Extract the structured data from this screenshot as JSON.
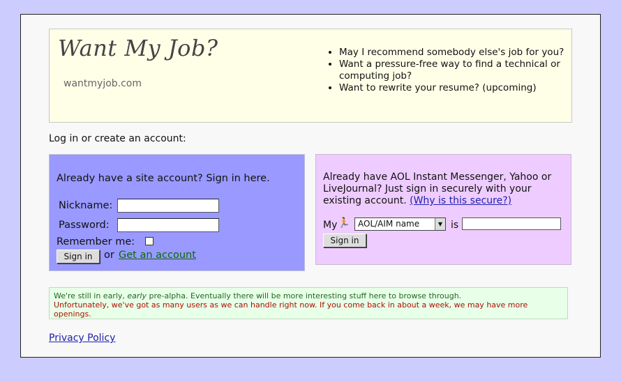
{
  "header": {
    "title": "Want My Job?",
    "domain": "wantmyjob.com",
    "pitch": [
      "May I recommend somebody else's job for you?",
      "Want a pressure-free way to find a technical or computing job?",
      "Want to rewrite your resume? (upcoming)"
    ]
  },
  "prompt": "Log in or create an account:",
  "site_login": {
    "heading": "Already have a site account? Sign in here.",
    "nickname_label": "Nickname:",
    "password_label": "Password:",
    "remember_label": "Remember me:",
    "signin_label": "Sign in",
    "or_text": "or",
    "get_account_label": "Get an account",
    "colors": {
      "panel": "#9999ff"
    }
  },
  "im_login": {
    "text": "Already have AOL Instant Messenger, Yahoo or LiveJournal? Just sign in securely with your existing account.",
    "why_link": "(Why is this secure?)",
    "my_label": "My",
    "aim_icon": "aim-running-man-icon",
    "select_value": "AOL/AIM name",
    "is_label": "is",
    "signin_label": "Sign in",
    "colors": {
      "panel": "#eeccff"
    }
  },
  "notice": {
    "line1_before": "We're still in early, ",
    "line1_em": "early",
    "line1_after": " pre-alpha. Eventually there will be more interesting stuff here to browse through.",
    "line2": "Unfortunately, we've got as many users as we can handle right now. If you come back in about a week, we may have more openings."
  },
  "footer": {
    "privacy_label": "Privacy Policy"
  }
}
